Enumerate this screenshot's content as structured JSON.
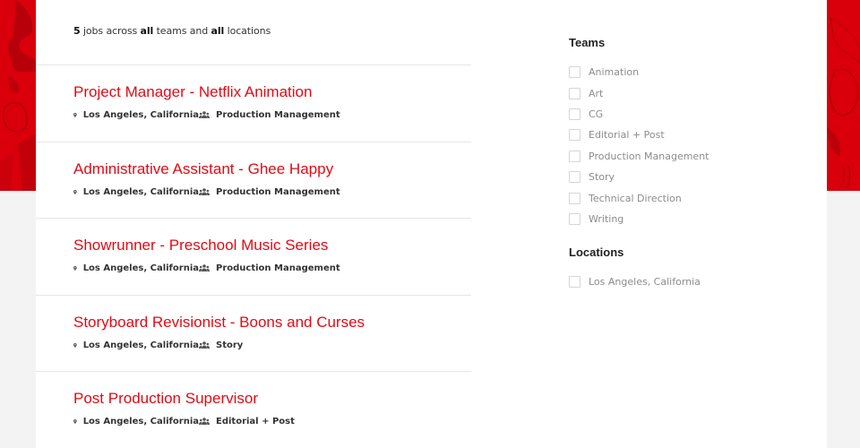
{
  "brand": {
    "accent_color": "#e50914",
    "banner_color": "#d9000b"
  },
  "summary": {
    "count": "5",
    "text_1": " jobs across ",
    "teams_value": "all",
    "text_2": " teams and ",
    "locations_value": "all",
    "text_3": " locations"
  },
  "jobs": [
    {
      "title": "Project Manager - Netflix Animation",
      "location": "Los Angeles, California",
      "team": "Production Management"
    },
    {
      "title": "Administrative Assistant - Ghee Happy",
      "location": "Los Angeles, California",
      "team": "Production Management"
    },
    {
      "title": "Showrunner - Preschool Music Series",
      "location": "Los Angeles, California",
      "team": "Production Management"
    },
    {
      "title": "Storyboard Revisionist - Boons and Curses",
      "location": "Los Angeles, California",
      "team": "Story"
    },
    {
      "title": "Post Production Supervisor",
      "location": "Los Angeles, California",
      "team": "Editorial + Post"
    }
  ],
  "filters": {
    "teams": {
      "heading": "Teams",
      "options": [
        {
          "label": "Animation",
          "checked": false
        },
        {
          "label": "Art",
          "checked": false
        },
        {
          "label": "CG",
          "checked": false
        },
        {
          "label": "Editorial + Post",
          "checked": false
        },
        {
          "label": "Production Management",
          "checked": false
        },
        {
          "label": "Story",
          "checked": false
        },
        {
          "label": "Technical Direction",
          "checked": false
        },
        {
          "label": "Writing",
          "checked": false
        }
      ]
    },
    "locations": {
      "heading": "Locations",
      "options": [
        {
          "label": "Los Angeles, California",
          "checked": false
        }
      ]
    }
  },
  "icons": {
    "location": "map-pin-icon",
    "team": "people-group-icon"
  }
}
